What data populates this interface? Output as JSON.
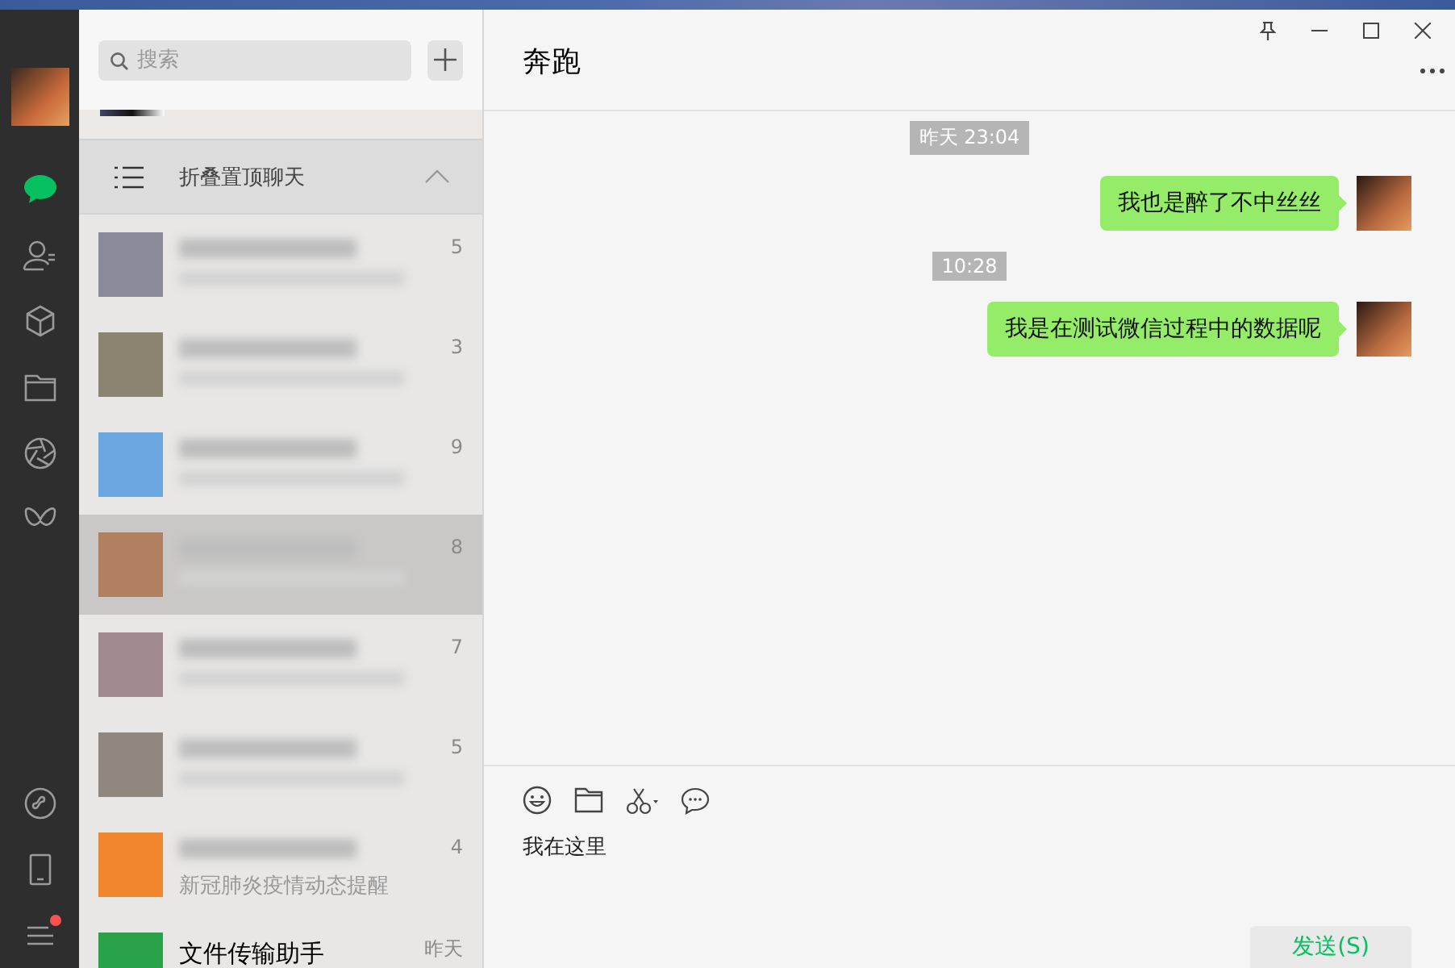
{
  "sidebar": {
    "nav": [
      {
        "kind": "chats",
        "selected": true
      },
      {
        "kind": "contacts",
        "selected": false
      },
      {
        "kind": "cube",
        "selected": false
      },
      {
        "kind": "folder",
        "selected": false
      },
      {
        "kind": "aperture",
        "selected": false
      },
      {
        "kind": "butterfly",
        "selected": false
      }
    ],
    "bottom": [
      {
        "kind": "miniprogram",
        "badge": false
      },
      {
        "kind": "phone",
        "badge": false
      },
      {
        "kind": "menu",
        "badge": true
      }
    ]
  },
  "chat_list": {
    "search": {
      "placeholder": "搜索"
    },
    "folded_pinned": {
      "label": "折叠置顶聊天",
      "expanded": true
    },
    "chats": [
      {
        "time": "5",
        "color": "#8a8a9a",
        "selected": false
      },
      {
        "time": "3",
        "color": "#8a8470",
        "selected": false
      },
      {
        "time": "9",
        "color": "#6aa6e0",
        "selected": false
      },
      {
        "time": "8",
        "color": "#b08060",
        "selected": true
      },
      {
        "time": "7",
        "color": "#a08a90",
        "selected": false
      },
      {
        "time": "5",
        "color": "#908880",
        "selected": false
      },
      {
        "time": "4",
        "color": "#f0872e",
        "preview": "新冠肺炎疫情动态提醒",
        "selected": false
      },
      {
        "title": "文件传输助手",
        "time": "昨天",
        "color": "#2aa24a",
        "selected": false
      }
    ]
  },
  "chat": {
    "title": "奔跑",
    "messages": [
      {
        "kind": "time",
        "text": "昨天 23:04"
      },
      {
        "kind": "message",
        "text": "我也是醉了不中丝丝"
      },
      {
        "kind": "time",
        "text": "10:28"
      },
      {
        "kind": "message",
        "text": "我是在测试微信过程中的数据呢"
      }
    ],
    "input": {
      "value": "我在这里"
    },
    "send_button": "发送(S)"
  }
}
